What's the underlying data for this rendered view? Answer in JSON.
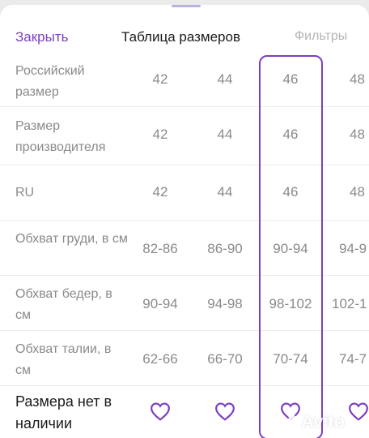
{
  "header": {
    "close_label": "Закрыть",
    "title": "Таблица размеров",
    "filters_label": "Фильтры"
  },
  "rows": [
    {
      "label": "Российский размер",
      "values": [
        "42",
        "44",
        "46",
        "48"
      ]
    },
    {
      "label": "Размер производителя",
      "values": [
        "42",
        "44",
        "46",
        "48"
      ]
    },
    {
      "label": "RU",
      "values": [
        "42",
        "44",
        "46",
        "48"
      ]
    },
    {
      "label": "Обхват груди, в см",
      "values": [
        "82-86",
        "86-90",
        "90-94",
        "94-9"
      ]
    },
    {
      "label": "Обхват бедер, в см",
      "values": [
        "90-94",
        "94-98",
        "98-102",
        "102-1"
      ]
    },
    {
      "label": "Обхват талии, в см",
      "values": [
        "62-66",
        "66-70",
        "70-74",
        "74-7"
      ]
    }
  ],
  "availability": {
    "label": "Размера нет в наличии",
    "icon": "heart-icon"
  },
  "selected_column_index": 2,
  "watermark": "Avito",
  "colors": {
    "accent": "#7b3fc2",
    "muted_text": "#8a8a8a",
    "disabled_text": "#b5b5b5"
  }
}
